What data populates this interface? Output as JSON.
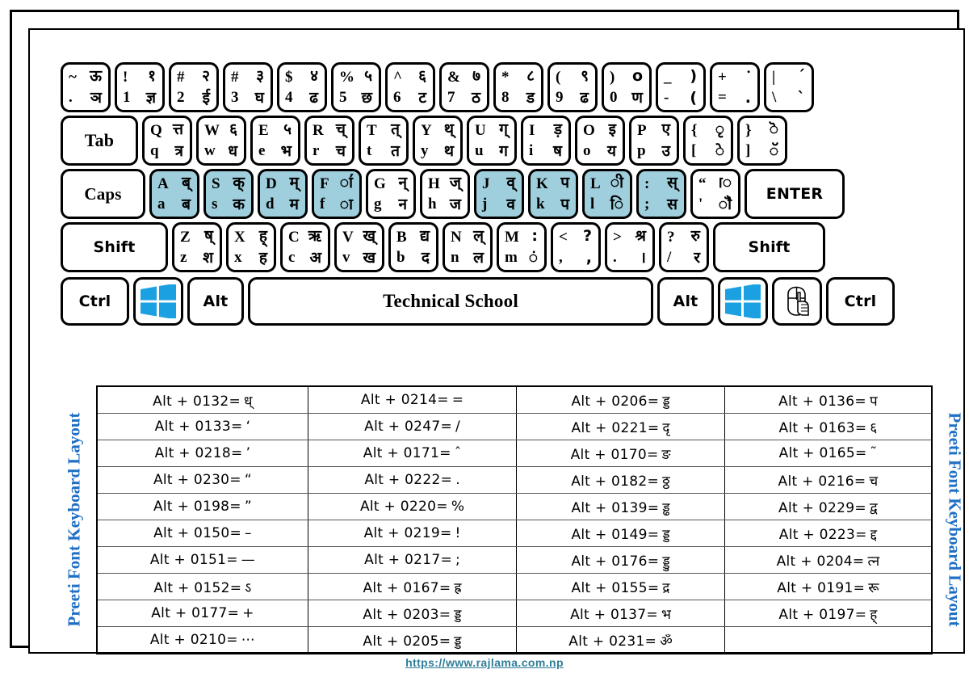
{
  "title": "Preeti Font Keyboard Layout",
  "side_label_left": "Preeti Font  Keyboard Layout",
  "side_label_right": "Preeti Font Keyboard Layout",
  "footer": {
    "url": "https://www.rajlama.com.np"
  },
  "colors": {
    "highlight_key": "#9fcfdd",
    "windows_logo": "#1BA1E2",
    "side_label_text": "#1f6fc4",
    "footer_link": "#2e7d98",
    "key_border": "#000000"
  },
  "keyboard": {
    "row1": [
      {
        "tl": "~",
        "tr": "ऊ",
        "bl": ".",
        "br": "ञ",
        "highlight": false
      },
      {
        "tl": "!",
        "tr": "१",
        "bl": "1",
        "br": "ज्ञ",
        "highlight": false
      },
      {
        "tl": "#",
        "tr": "२",
        "bl": "2",
        "br": "ई",
        "highlight": false
      },
      {
        "tl": "#",
        "tr": "३",
        "bl": "3",
        "br": "घ",
        "highlight": false
      },
      {
        "tl": "$",
        "tr": "४",
        "bl": "4",
        "br": "ढ",
        "highlight": false
      },
      {
        "tl": "%",
        "tr": "५",
        "bl": "5",
        "br": "छ",
        "highlight": false
      },
      {
        "tl": "^",
        "tr": "६",
        "bl": "6",
        "br": "ट",
        "highlight": false
      },
      {
        "tl": "&",
        "tr": "७",
        "bl": "7",
        "br": "ठ",
        "highlight": false
      },
      {
        "tl": "*",
        "tr": "८",
        "bl": "8",
        "br": "ड",
        "highlight": false
      },
      {
        "tl": "(",
        "tr": "९",
        "bl": "9",
        "br": "ढ",
        "highlight": false
      },
      {
        "tl": ")",
        "tr": "o",
        "bl": "0",
        "br": "ण",
        "highlight": false
      },
      {
        "tl": "_",
        "tr": ")",
        "bl": "-",
        "br": "(",
        "highlight": false
      },
      {
        "tl": "+",
        "tr": "ॱ",
        "bl": "=",
        "br": ".",
        "highlight": false
      },
      {
        "tl": "|",
        "tr": "´",
        "bl": "\\",
        "br": "`",
        "highlight": false
      }
    ],
    "row2_tab": "Tab",
    "row2": [
      {
        "tl": "Q",
        "tr": "त्त",
        "bl": "q",
        "br": "त्र",
        "highlight": false
      },
      {
        "tl": "W",
        "tr": "६",
        "bl": "w",
        "br": "ध",
        "highlight": false
      },
      {
        "tl": "E",
        "tr": "५",
        "bl": "e",
        "br": "भ",
        "highlight": false
      },
      {
        "tl": "R",
        "tr": "च्",
        "bl": "r",
        "br": "च",
        "highlight": false
      },
      {
        "tl": "T",
        "tr": "त्",
        "bl": "t",
        "br": "त",
        "highlight": false
      },
      {
        "tl": "Y",
        "tr": "थ्",
        "bl": "y",
        "br": "थ",
        "highlight": false
      },
      {
        "tl": "U",
        "tr": "ग्",
        "bl": "u",
        "br": "ग",
        "highlight": false
      },
      {
        "tl": "I",
        "tr": "ड़",
        "bl": "i",
        "br": "ष",
        "highlight": false
      },
      {
        "tl": "O",
        "tr": "इ",
        "bl": "o",
        "br": "य",
        "highlight": false
      },
      {
        "tl": "P",
        "tr": "ए",
        "bl": "p",
        "br": "उ",
        "highlight": false
      },
      {
        "tl": "{",
        "tr": "ृ",
        "bl": "[",
        "br": "े",
        "highlight": false
      },
      {
        "tl": "}",
        "tr": "ॆ",
        "bl": "]",
        "br": "ॅ",
        "highlight": false
      }
    ],
    "row3_caps": "Caps",
    "row3_enter": "ENTER",
    "row3": [
      {
        "tl": "A",
        "tr": "ब्",
        "bl": "a",
        "br": "ब",
        "highlight": true
      },
      {
        "tl": "S",
        "tr": "क्",
        "bl": "s",
        "br": "क",
        "highlight": true
      },
      {
        "tl": "D",
        "tr": "म्",
        "bl": "d",
        "br": "म",
        "highlight": true
      },
      {
        "tl": "F",
        "tr": "ा॔",
        "bl": "f",
        "br": "ा",
        "highlight": true
      },
      {
        "tl": "G",
        "tr": "न्",
        "bl": "g",
        "br": "न",
        "highlight": false
      },
      {
        "tl": "H",
        "tr": "ज्",
        "bl": "h",
        "br": "ज",
        "highlight": false
      },
      {
        "tl": "J",
        "tr": "व्",
        "bl": "j",
        "br": "व",
        "highlight": true
      },
      {
        "tl": "K",
        "tr": "प",
        "bl": "k",
        "br": "प",
        "highlight": true
      },
      {
        "tl": "L",
        "tr": "ी",
        "bl": "l",
        "br": "ि",
        "highlight": true
      },
      {
        "tl": ":",
        "tr": "स्",
        "bl": ";",
        "br": "स",
        "highlight": true
      },
      {
        "tl": "“",
        "tr": "ॎ",
        "bl": "'",
        "br": "ॏ",
        "highlight": false
      }
    ],
    "row4_shift_left": "Shift",
    "row4_shift_right": "Shift",
    "row4": [
      {
        "tl": "Z",
        "tr": "ष्",
        "bl": "z",
        "br": "श",
        "highlight": false
      },
      {
        "tl": "X",
        "tr": "ह्",
        "bl": "x",
        "br": "ह",
        "highlight": false
      },
      {
        "tl": "C",
        "tr": "ऋ",
        "bl": "c",
        "br": "अ",
        "highlight": false
      },
      {
        "tl": "V",
        "tr": "ख्",
        "bl": "v",
        "br": "ख",
        "highlight": false
      },
      {
        "tl": "B",
        "tr": "द्य",
        "bl": "b",
        "br": "द",
        "highlight": false
      },
      {
        "tl": "N",
        "tr": "ल्",
        "bl": "n",
        "br": "ल",
        "highlight": false
      },
      {
        "tl": "M",
        "tr": ":",
        "bl": "m",
        "br": "ं",
        "highlight": false
      },
      {
        "tl": "<",
        "tr": "?",
        "bl": ",",
        "br": ",",
        "highlight": false
      },
      {
        "tl": ">",
        "tr": "श्र",
        "bl": ".",
        "br": "।",
        "highlight": false
      },
      {
        "tl": "?",
        "tr": "रु",
        "bl": "/",
        "br": "र",
        "highlight": false
      }
    ],
    "row5": {
      "ctrl_left": "Ctrl",
      "win_left": "windows-logo",
      "alt_left": "Alt",
      "space": "Technical School",
      "alt_right": "Alt",
      "win_right": "windows-logo",
      "menu": "context-menu-icon",
      "ctrl_right": "Ctrl"
    }
  },
  "alt_codes": [
    [
      {
        "code": "Alt + 0132=",
        "glyph": "ध्"
      },
      {
        "code": "Alt + 0214=",
        "glyph": "="
      },
      {
        "code": "Alt + 0206=",
        "glyph": "ड्ड"
      },
      {
        "code": "Alt + 0136=",
        "glyph": "प"
      }
    ],
    [
      {
        "code": "Alt + 0133=",
        "glyph": "‘"
      },
      {
        "code": "Alt + 0247=",
        "glyph": "/"
      },
      {
        "code": "Alt + 0221=",
        "glyph": "दृ"
      },
      {
        "code": "Alt + 0163=",
        "glyph": "६"
      }
    ],
    [
      {
        "code": "Alt + 0218=",
        "glyph": "’"
      },
      {
        "code": "Alt + 0171=",
        "glyph": "ˆ"
      },
      {
        "code": "Alt + 0170=",
        "glyph": "ङ"
      },
      {
        "code": "Alt + 0165=",
        "glyph": "˜"
      }
    ],
    [
      {
        "code": "Alt + 0230=",
        "glyph": "“"
      },
      {
        "code": "Alt + 0222=",
        "glyph": "."
      },
      {
        "code": "Alt + 0182=",
        "glyph": "ठ्ठ"
      },
      {
        "code": "Alt + 0216=",
        "glyph": "च"
      }
    ],
    [
      {
        "code": "Alt + 0198=",
        "glyph": "”"
      },
      {
        "code": "Alt + 0220=",
        "glyph": "%"
      },
      {
        "code": "Alt + 0139=",
        "glyph": "ड्ढ"
      },
      {
        "code": "Alt + 0229=",
        "glyph": "द्व"
      }
    ],
    [
      {
        "code": "Alt + 0150=",
        "glyph": "–"
      },
      {
        "code": "Alt + 0219=",
        "glyph": "!"
      },
      {
        "code": "Alt + 0149=",
        "glyph": "ड्ड"
      },
      {
        "code": "Alt + 0223=",
        "glyph": "द्द"
      }
    ],
    [
      {
        "code": "Alt + 0151=",
        "glyph": "—"
      },
      {
        "code": "Alt + 0217=",
        "glyph": ";"
      },
      {
        "code": "Alt + 0176=",
        "glyph": "ड्डु"
      },
      {
        "code": "Alt + 0204=",
        "glyph": "त्न"
      }
    ],
    [
      {
        "code": "Alt + 0152=",
        "glyph": "ऽ"
      },
      {
        "code": "Alt + 0167=",
        "glyph": "ह्र"
      },
      {
        "code": "Alt + 0155=",
        "glyph": "द्र"
      },
      {
        "code": "Alt + 0191=",
        "glyph": "रू"
      }
    ],
    [
      {
        "code": "Alt + 0177=",
        "glyph": "+"
      },
      {
        "code": "Alt + 0203=",
        "glyph": "ड्ड"
      },
      {
        "code": "Alt + 0137=",
        "glyph": "भ"
      },
      {
        "code": "Alt + 0197=",
        "glyph": "ह्"
      }
    ],
    [
      {
        "code": "Alt + 0210=",
        "glyph": "⋯"
      },
      {
        "code": "Alt + 0205=",
        "glyph": "ड्ड"
      },
      {
        "code": "Alt + 0231=",
        "glyph": "ॐ"
      },
      {
        "code": "",
        "glyph": ""
      }
    ]
  ]
}
